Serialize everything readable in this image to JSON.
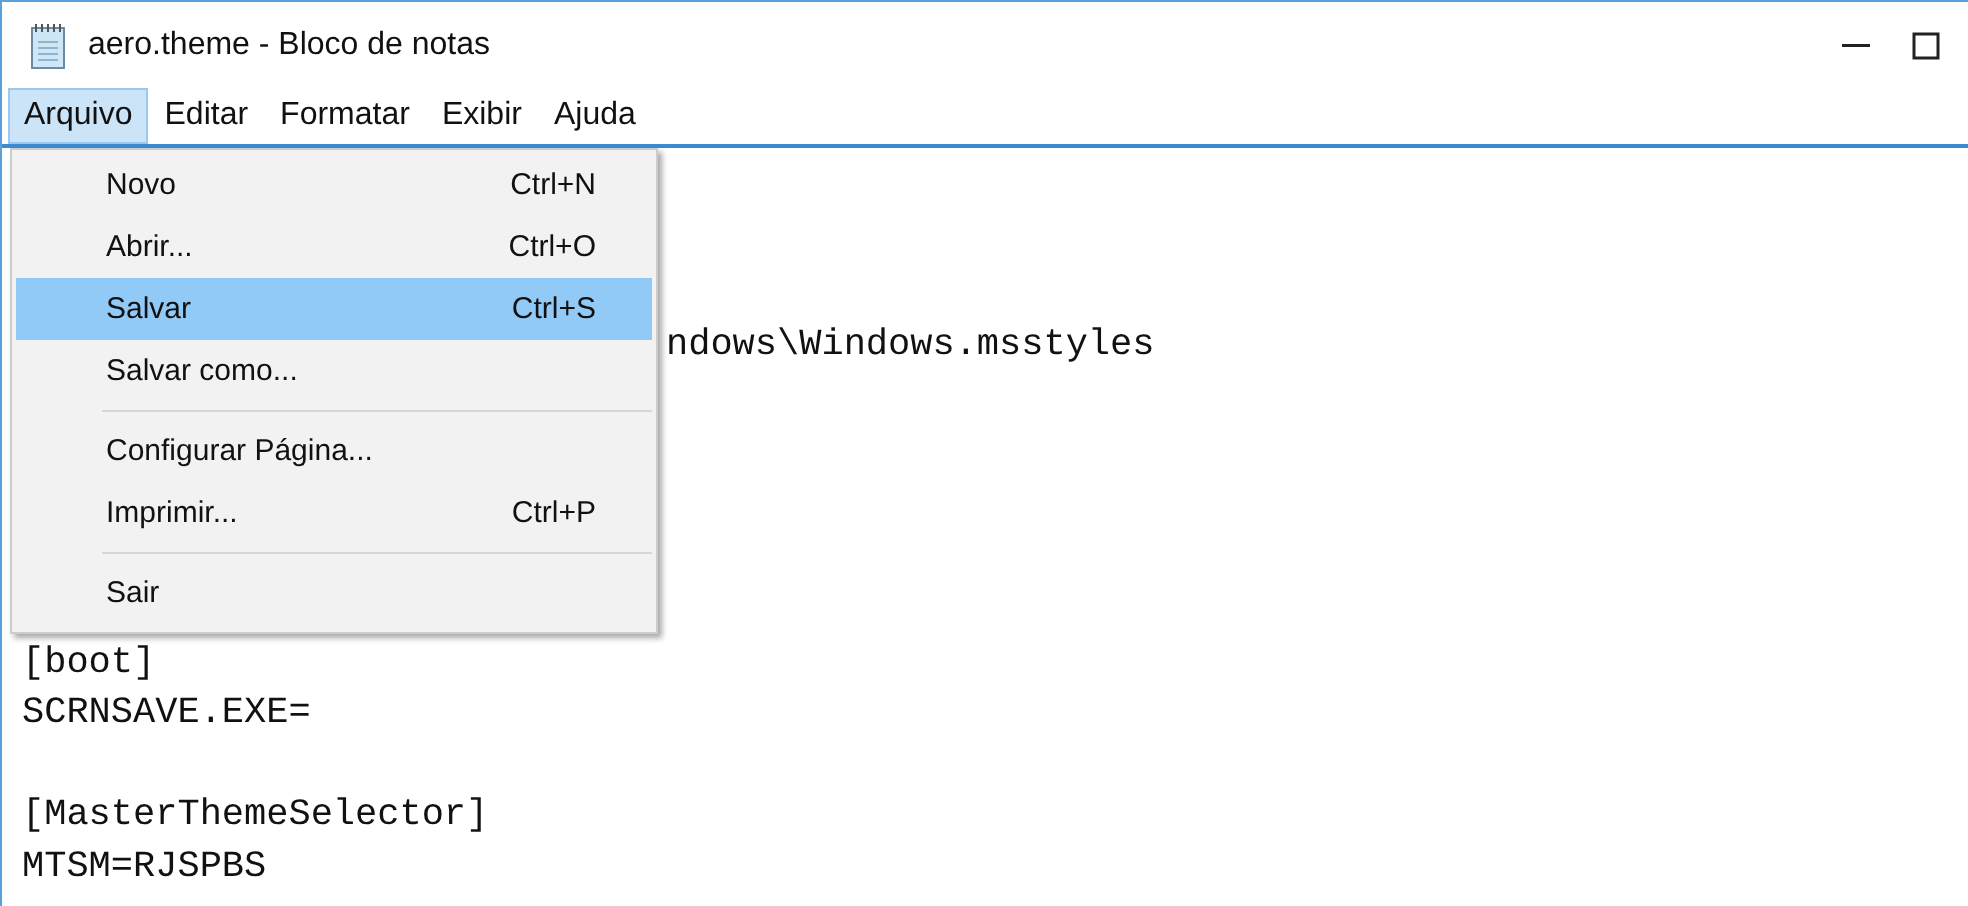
{
  "window": {
    "title": "aero.theme - Bloco de notas"
  },
  "menu_bar": [
    {
      "label": "Arquivo",
      "selected": true
    },
    {
      "label": "Editar",
      "selected": false
    },
    {
      "label": "Formatar",
      "selected": false
    },
    {
      "label": "Exibir",
      "selected": false
    },
    {
      "label": "Ajuda",
      "selected": false
    }
  ],
  "menu": [
    {
      "kind": "item",
      "label": "Novo",
      "shortcut": "Ctrl+N",
      "selected": false
    },
    {
      "kind": "item",
      "label": "Abrir...",
      "shortcut": "Ctrl+O",
      "selected": false
    },
    {
      "kind": "item",
      "label": "Salvar",
      "shortcut": "Ctrl+S",
      "selected": true
    },
    {
      "kind": "item",
      "label": "Salvar como...",
      "selected": false
    },
    {
      "kind": "separator"
    },
    {
      "kind": "item",
      "label": "Configurar Página...",
      "selected": false
    },
    {
      "kind": "item",
      "label": "Imprimir...",
      "shortcut": "Ctrl+P",
      "selected": false
    },
    {
      "kind": "separator"
    },
    {
      "kind": "item",
      "label": "Sair",
      "selected": false
    }
  ],
  "editor_lines": [
    {
      "kind": "partial",
      "text": "ndows\\Windows.msstyles"
    },
    {
      "kind": "line",
      "text": "[boot]"
    },
    {
      "kind": "line",
      "text": "SCRNSAVE.EXE="
    },
    {
      "kind": "blank"
    },
    {
      "kind": "line",
      "text": "[MasterThemeSelector]"
    },
    {
      "kind": "line",
      "text": "MTSM=RJSPBS"
    }
  ]
}
